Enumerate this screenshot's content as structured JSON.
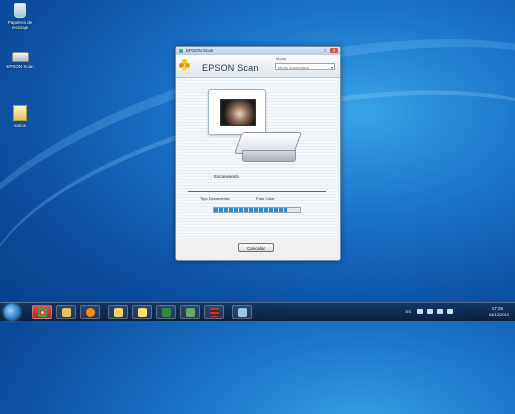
{
  "desktop": {
    "icons": [
      {
        "label": "Papelera de reciclaje"
      },
      {
        "label": "EPSON Scan"
      },
      {
        "label": "varios"
      }
    ]
  },
  "window": {
    "title": "EPSON Scan",
    "controls": {
      "help": "?",
      "close": "✕"
    },
    "brand": "EPSON Scan",
    "mode_label": "Modo",
    "mode_value": "Modo Automático",
    "status": "Escaneando",
    "doc_type_label": "Tipo Documento:",
    "doc_type_value": "Foto Color",
    "progress": 0.85,
    "cancel_label": "Cancelar"
  },
  "taskbar": {
    "language": "ES",
    "time": "17:25",
    "date": "04/12/2012"
  },
  "colors": {
    "accent": "#2a8ad8",
    "desktop": "#1a73c8",
    "close": "#d9534f"
  }
}
